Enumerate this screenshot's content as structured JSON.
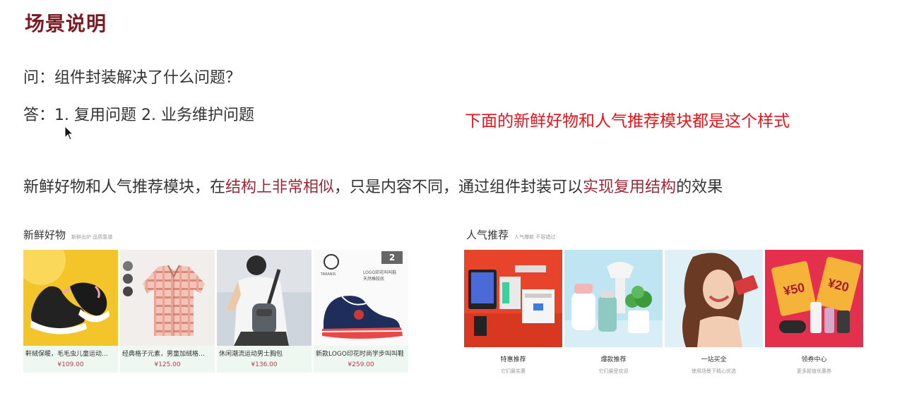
{
  "slide": {
    "title": "场景说明",
    "question": "问：组件封装解决了什么问题？",
    "answer": "答：1. 复用问题   2. 业务维护问题",
    "note": "下面的新鲜好物和人气推荐模块都是这个样式",
    "description": {
      "part1": "新鲜好物和人气推荐模块，在",
      "highlight1": "结构上非常相似",
      "part2": "，只是内容不同，通过组件封装可以",
      "highlight2": "实现复用结构",
      "part3": "的效果"
    }
  },
  "fresh_goods": {
    "title": "新鲜好物",
    "subtitle": "新鲜出炉 品质靠谱",
    "items": [
      {
        "name": "軒絨保暖，毛毛虫儿童运动…",
        "price": "¥109.00",
        "icon": "sneaker-image"
      },
      {
        "name": "经典格子元素，男童加绒格…",
        "price": "¥125.00",
        "icon": "plaid-jacket-image"
      },
      {
        "name": "休闲潮流运动男士胸包",
        "price": "¥136.00",
        "icon": "chest-bag-image"
      },
      {
        "name": "新款LOGO印花时尚学步叫叫鞋",
        "price": "¥259.00",
        "icon": "toddler-shoe-image"
      }
    ]
  },
  "popular": {
    "title": "人气推荐",
    "subtitle": "人气爆款 不容错过",
    "items": [
      {
        "name": "特惠推荐",
        "desc": "它们最实惠",
        "icon": "electronics-image"
      },
      {
        "name": "爆款推荐",
        "desc": "它们最受欢迎",
        "icon": "appliances-image"
      },
      {
        "name": "一站买全",
        "desc": "使用场景下精心优选",
        "icon": "woman-shopping-image"
      },
      {
        "name": "领券中心",
        "desc": "更多超值优惠券",
        "icon": "coupon-image"
      }
    ]
  },
  "picture_labels": {
    "shoe_badge": "2",
    "shoe_brand": "TARANIS",
    "shoe_caption": "LOGO印花叫叫鞋 天然橡胶底",
    "coupon_a": "¥50",
    "coupon_b": "¥20"
  },
  "colors": {
    "title": "#7b1c24",
    "note": "#e8141a",
    "highlight": "#9b2a3a",
    "price": "#c2394a",
    "card_bg": "#eef8f0"
  }
}
